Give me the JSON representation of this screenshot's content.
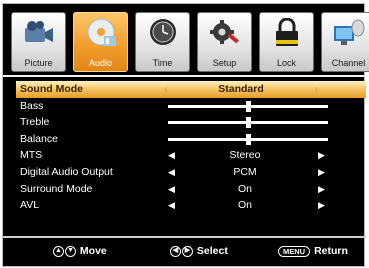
{
  "tabs": [
    {
      "id": "picture",
      "label": "Picture",
      "icon": "video-camera-icon",
      "active": false
    },
    {
      "id": "audio",
      "label": "Audio",
      "icon": "cd-audio-icon",
      "active": true
    },
    {
      "id": "time",
      "label": "Time",
      "icon": "clock-icon",
      "active": false
    },
    {
      "id": "setup",
      "label": "Setup",
      "icon": "gear-icon",
      "active": false
    },
    {
      "id": "lock",
      "label": "Lock",
      "icon": "padlock-icon",
      "active": false
    },
    {
      "id": "channel",
      "label": "Channel",
      "icon": "satellite-dish-icon",
      "active": false
    }
  ],
  "menu": {
    "sound_mode": {
      "label": "Sound Mode",
      "value": "Standard"
    },
    "bass": {
      "label": "Bass",
      "level": 0.5
    },
    "treble": {
      "label": "Treble",
      "level": 0.5
    },
    "balance": {
      "label": "Balance",
      "level": 0.5
    },
    "mts": {
      "label": "MTS",
      "value": "Stereo"
    },
    "digital_audio_output": {
      "label": "Digital Audio Output",
      "value": "PCM"
    },
    "surround_mode": {
      "label": "Surround Mode",
      "value": "On"
    },
    "avl": {
      "label": "AVL",
      "value": "On"
    }
  },
  "arrows": {
    "left": "◀",
    "right": "▶",
    "left_sel": "‹",
    "right_sel": "›"
  },
  "footer": {
    "move_label": "Move",
    "select_label": "Select",
    "menu_key": "MENU",
    "return_label": "Return"
  },
  "colors": {
    "accent": "#f4a233",
    "highlight": "#f5c869",
    "background": "#000000"
  }
}
